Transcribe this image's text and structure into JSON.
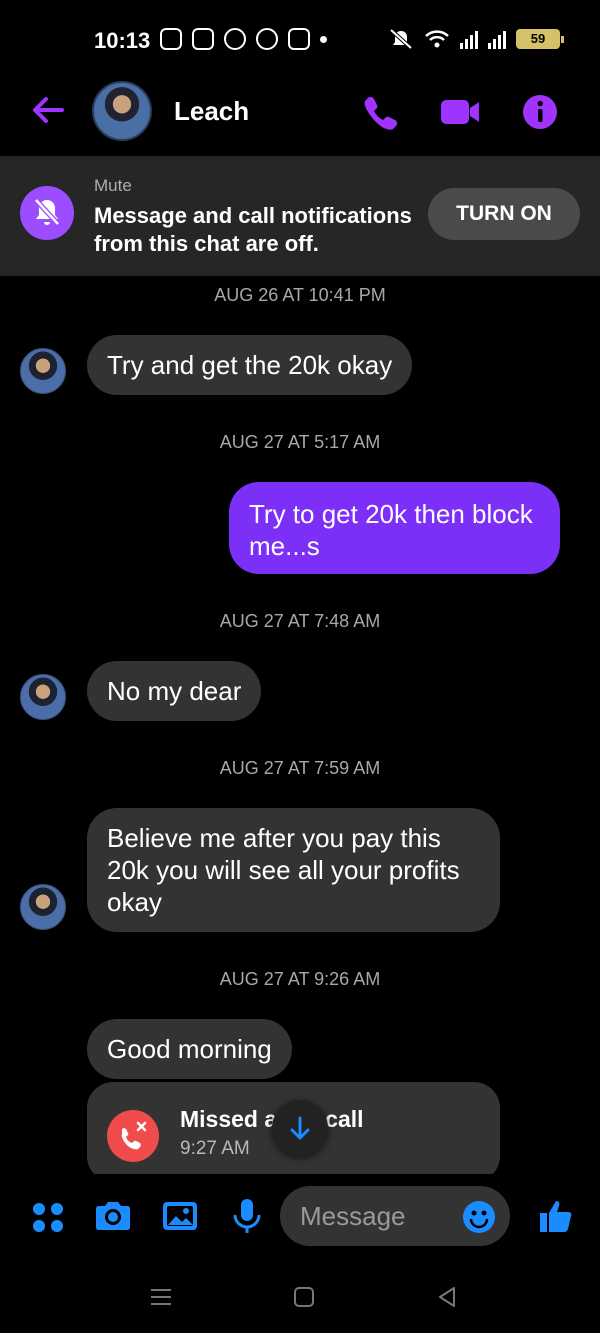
{
  "status_bar": {
    "time": "10:13",
    "battery": "59",
    "notif_icons": [
      "messenger-icon",
      "shop-icon",
      "facebook-icon",
      "recycle-icon",
      "youtube-icon",
      "dot"
    ]
  },
  "header": {
    "contact_name": "Leach",
    "accent_color": "#a033ff"
  },
  "mute_banner": {
    "title": "Mute",
    "text": "Message and call notifications from this chat are off.",
    "button_label": "TURN ON"
  },
  "chat": {
    "timestamps": [
      "AUG 26 AT 10:41 PM",
      "AUG 27 AT 5:17 AM",
      "AUG 27 AT 7:48 AM",
      "AUG 27 AT 7:59 AM",
      "AUG 27 AT 9:26 AM"
    ],
    "messages": [
      {
        "sender": "them",
        "text": "Try and get the 20k okay"
      },
      {
        "sender": "me",
        "text": "Try to get 20k then block me...s"
      },
      {
        "sender": "them",
        "text": "No my dear"
      },
      {
        "sender": "them",
        "text": "Believe me after you pay this 20k you will see all your profits okay"
      },
      {
        "sender": "them",
        "text": "Good morning"
      }
    ],
    "missed_call": {
      "title": "Missed audio call",
      "title_visible": "Missed a",
      "title_tail": "call",
      "time": "9:27 AM"
    },
    "outgoing_color": "#7b2ff7",
    "incoming_color": "#333333"
  },
  "composer": {
    "placeholder": "Message",
    "icon_color": "#1a8cff"
  }
}
